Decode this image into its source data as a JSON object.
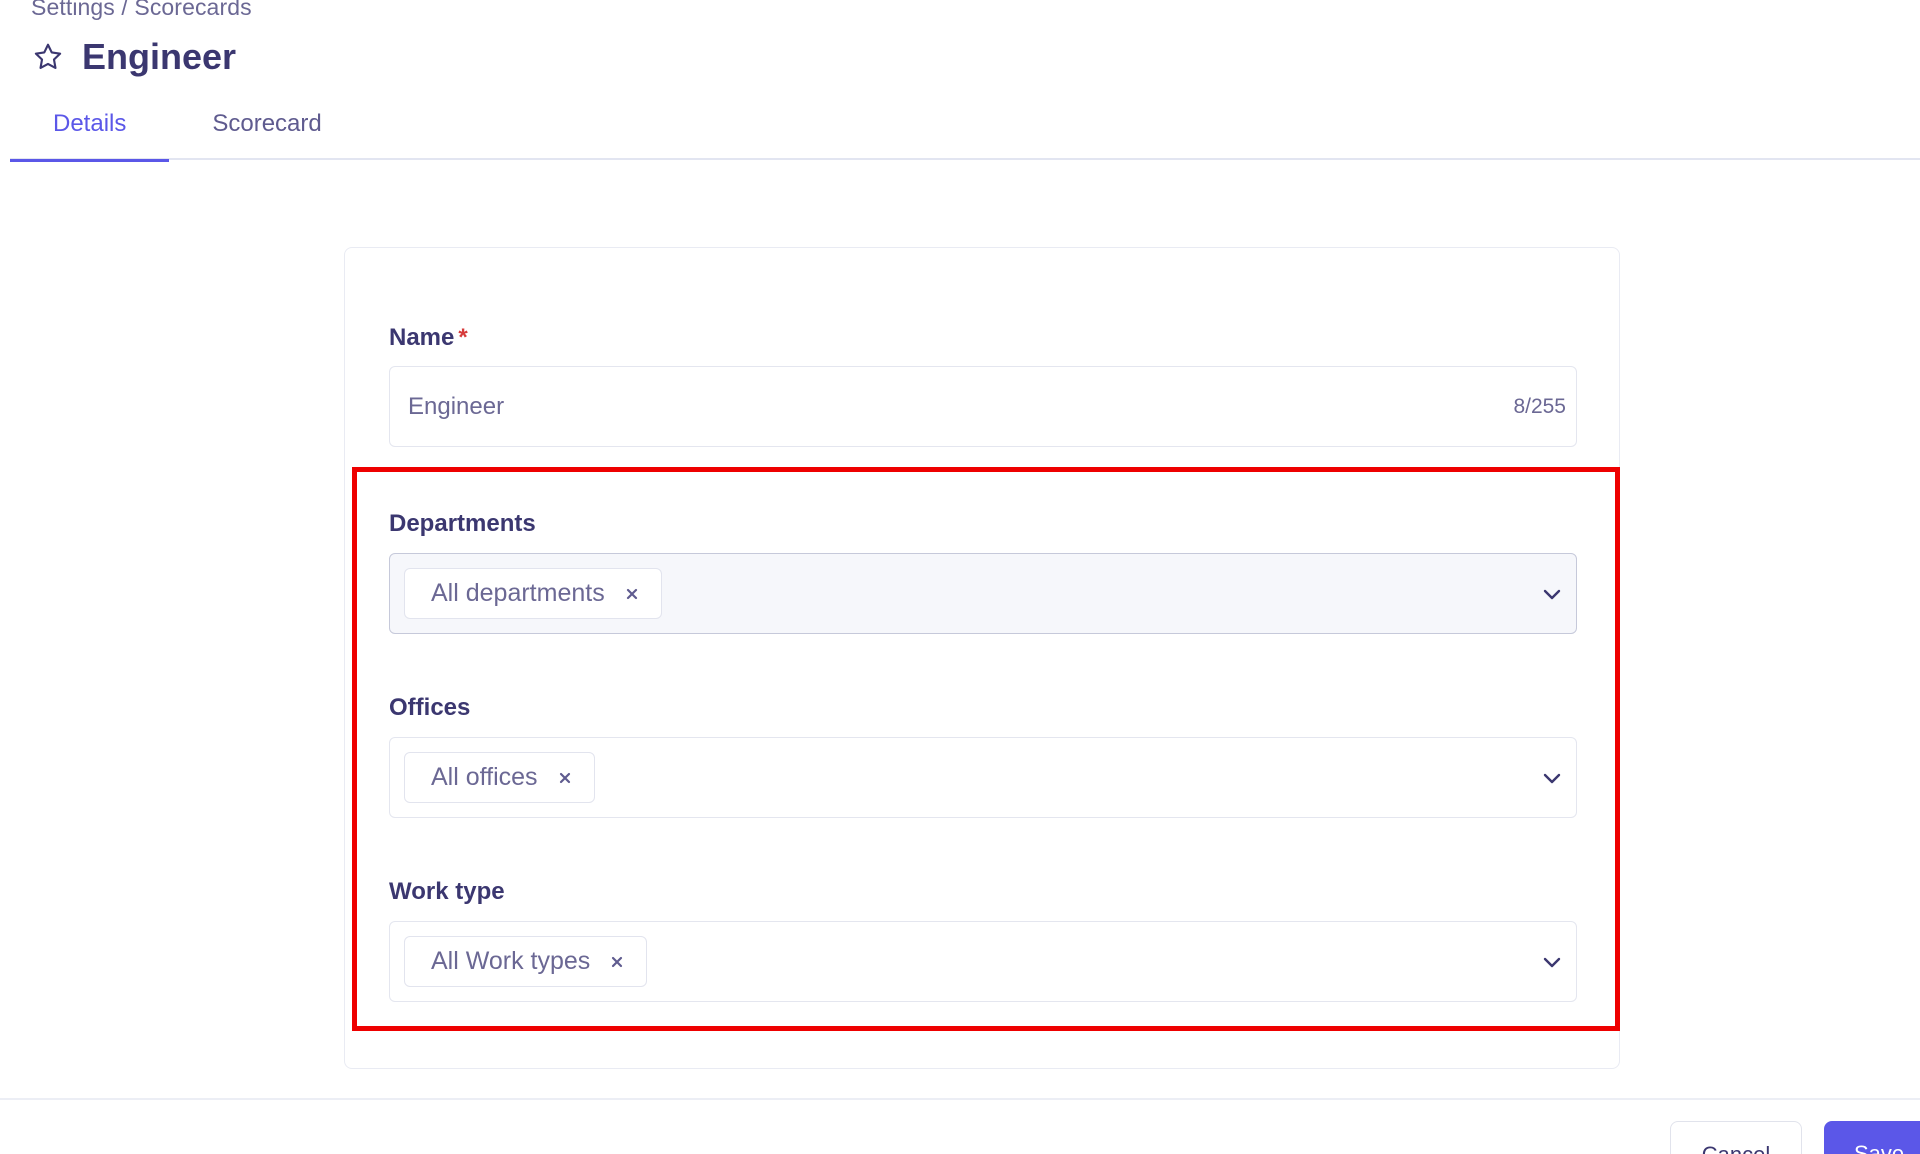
{
  "breadcrumb": "Settings / Scorecards",
  "title": "Engineer",
  "tabs": [
    {
      "label": "Details",
      "active": true
    },
    {
      "label": "Scorecard",
      "active": false
    }
  ],
  "form": {
    "name": {
      "label": "Name",
      "required_marker": "*",
      "value": "Engineer",
      "counter": "8/255"
    },
    "departments": {
      "label": "Departments",
      "selected": "All departments"
    },
    "offices": {
      "label": "Offices",
      "selected": "All offices"
    },
    "work_type": {
      "label": "Work type",
      "selected": "All Work types"
    }
  },
  "footer": {
    "cancel_label": "Cancel",
    "save_label": "Save"
  },
  "icons": {
    "star": "star-icon",
    "remove": "close-icon",
    "dropdown": "chevron-down-icon"
  },
  "colors": {
    "accent": "#5b57e8",
    "text": "#3b3770",
    "muted": "#6b6894",
    "required": "#d63b3b",
    "highlight": "#ee0000"
  }
}
